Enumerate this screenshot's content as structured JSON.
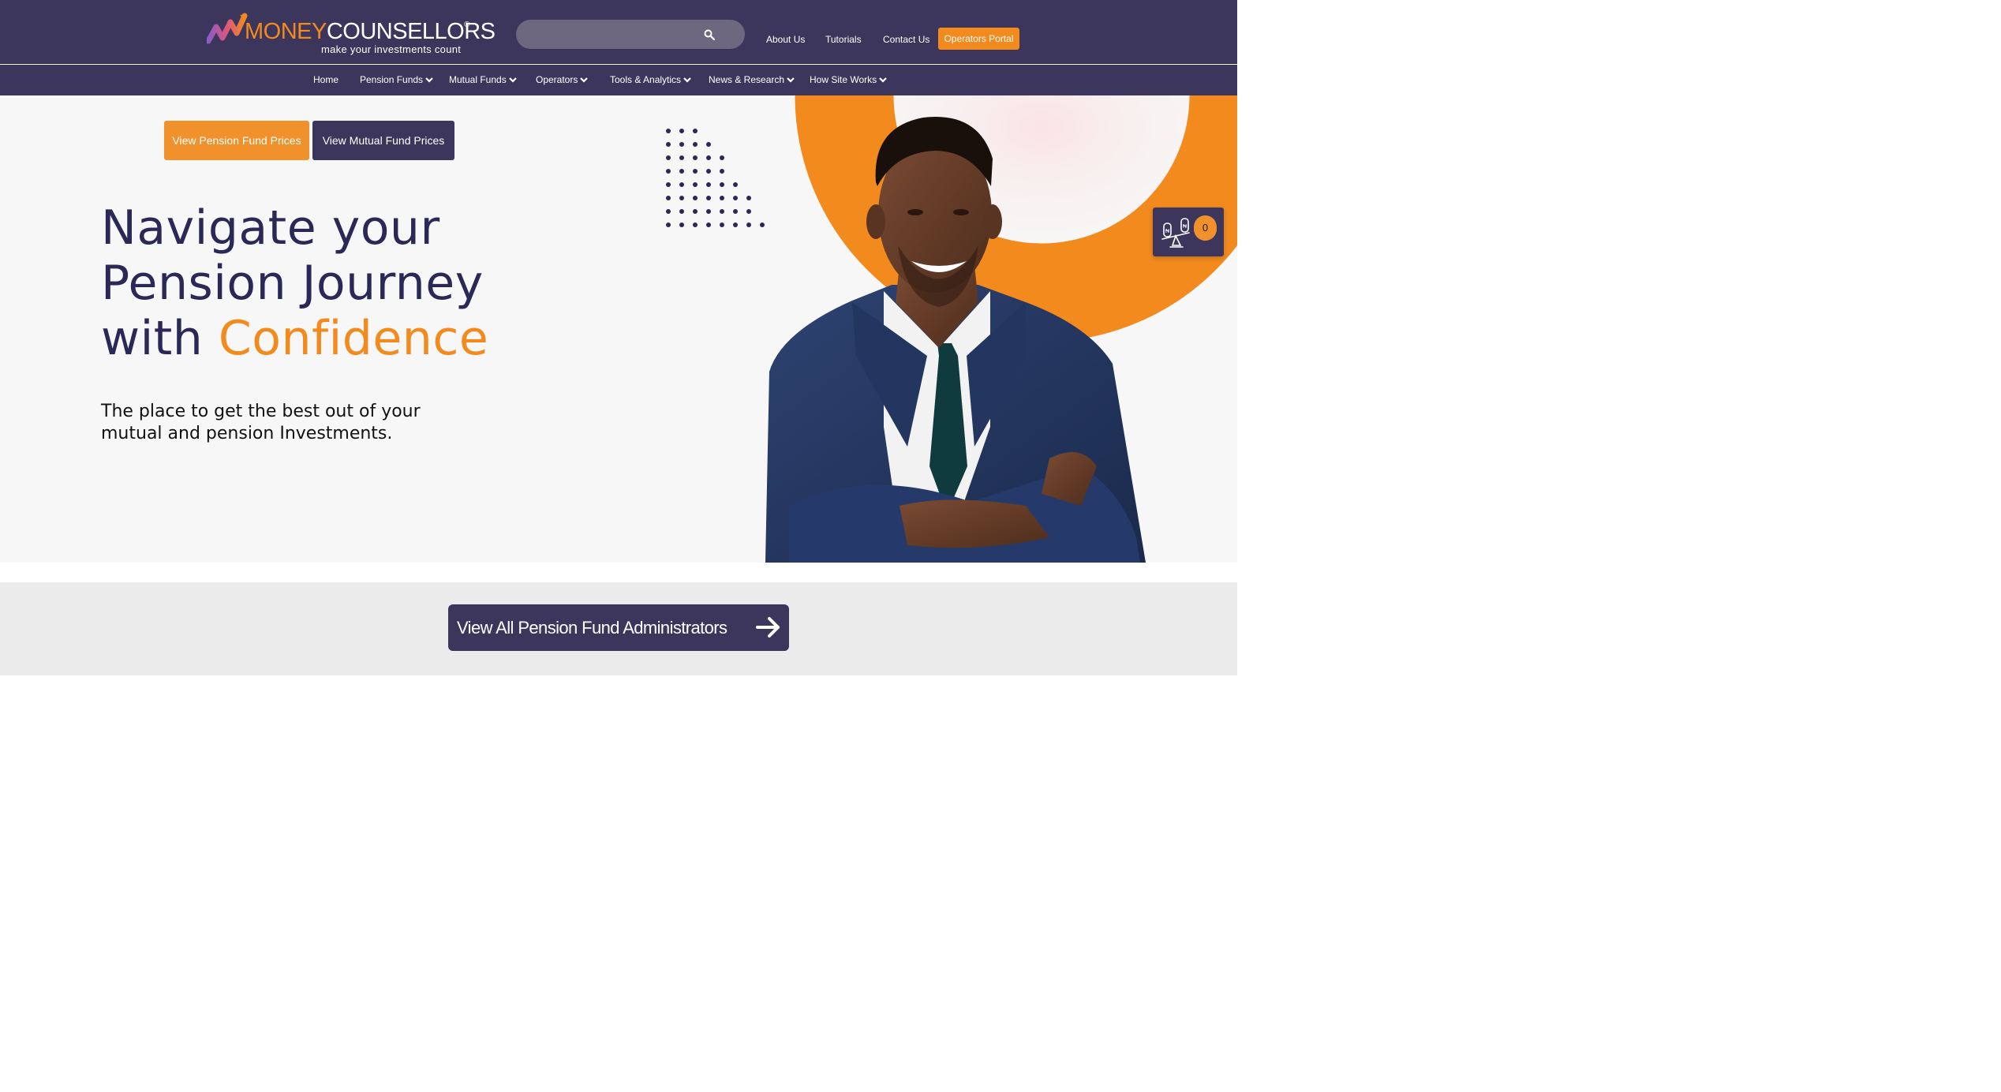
{
  "header": {
    "logo": {
      "word_a": "MONEY",
      "word_b": "COUNSELLORS",
      "registered": "®",
      "tagline": "make your investments count"
    },
    "search": {
      "placeholder": "",
      "icon": "search-icon"
    },
    "links": [
      {
        "label": "About Us"
      },
      {
        "label": "Tutorials"
      },
      {
        "label": "Contact Us"
      }
    ],
    "portal_button": "Operators Portal"
  },
  "nav": {
    "items": [
      {
        "label": "Home",
        "dropdown": false
      },
      {
        "label": "Pension Funds",
        "dropdown": true
      },
      {
        "label": "Mutual Funds",
        "dropdown": true
      },
      {
        "label": "Operators",
        "dropdown": true
      },
      {
        "label": "Tools & Analytics",
        "dropdown": true
      },
      {
        "label": "News & Research",
        "dropdown": true
      },
      {
        "label": "How Site Works",
        "dropdown": true
      }
    ]
  },
  "hero": {
    "buttons": {
      "pension": "View Pension Fund Prices",
      "mutual": "View Mutual Fund Prices"
    },
    "headline": {
      "line1": "Navigate your",
      "line2": "Pension Journey",
      "line3_prefix": "with ",
      "line3_accent": "Confidence"
    },
    "subline": {
      "line1": "The place to get the best out of your",
      "line2": "mutual and pension Investments."
    },
    "compare_widget": {
      "icon": "compare-scale-icon",
      "count": "0"
    }
  },
  "cta": {
    "label": "View All Pension Fund Administrators",
    "icon": "arrow-right-icon"
  },
  "colors": {
    "brand_purple": "#3d365c",
    "brand_orange": "#f28a1e",
    "headline": "#2b2857"
  }
}
